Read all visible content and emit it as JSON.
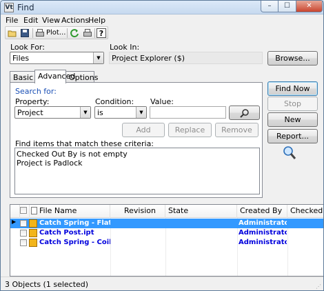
{
  "window": {
    "title": "Find",
    "app_icon": "Vt",
    "close_glyph": "✕",
    "minimize_glyph": "–",
    "maximize_glyph": "☐"
  },
  "menu": [
    "File",
    "Edit",
    "View",
    "Actions",
    "Help"
  ],
  "toolbar": {
    "plot_label": "Plot...",
    "help_glyph": "?"
  },
  "look_for": {
    "label": "Look For:",
    "value": "Files"
  },
  "look_in": {
    "label": "Look In:",
    "value": "Project Explorer ($)"
  },
  "buttons": {
    "browse": "Browse...",
    "find_now": "Find Now",
    "stop": "Stop",
    "new": "New",
    "report": "Report..."
  },
  "tabs": [
    "Basic",
    "Advanced",
    "Options"
  ],
  "advanced": {
    "group_title": "Search for:",
    "property_label": "Property:",
    "property_value": "Project",
    "condition_label": "Condition:",
    "condition_value": "is",
    "value_label": "Value:",
    "value_text": "",
    "add": "Add",
    "replace": "Replace",
    "remove": "Remove",
    "criteria_label": "Find items that match these criteria:",
    "criteria": [
      "Checked Out By is not empty",
      "Project is Padlock"
    ]
  },
  "results": {
    "columns": [
      "File Name",
      "Revision",
      "State",
      "Created By",
      "Checked In"
    ],
    "rows": [
      {
        "file": "Catch Spring - Flat.ipt",
        "revision": "",
        "state": "",
        "created_by": "Administrator",
        "selected": true
      },
      {
        "file": "Catch Post.ipt",
        "revision": "",
        "state": "",
        "created_by": "Administrator",
        "selected": false
      },
      {
        "file": "Catch Spring - Coil.ipt",
        "revision": "",
        "state": "",
        "created_by": "Administrator",
        "selected": false
      }
    ]
  },
  "status": "3 Objects (1 selected)",
  "colors": {
    "link_blue": "#1a4fb5",
    "selection": "#3399ff",
    "row_text": "#0000dd"
  }
}
